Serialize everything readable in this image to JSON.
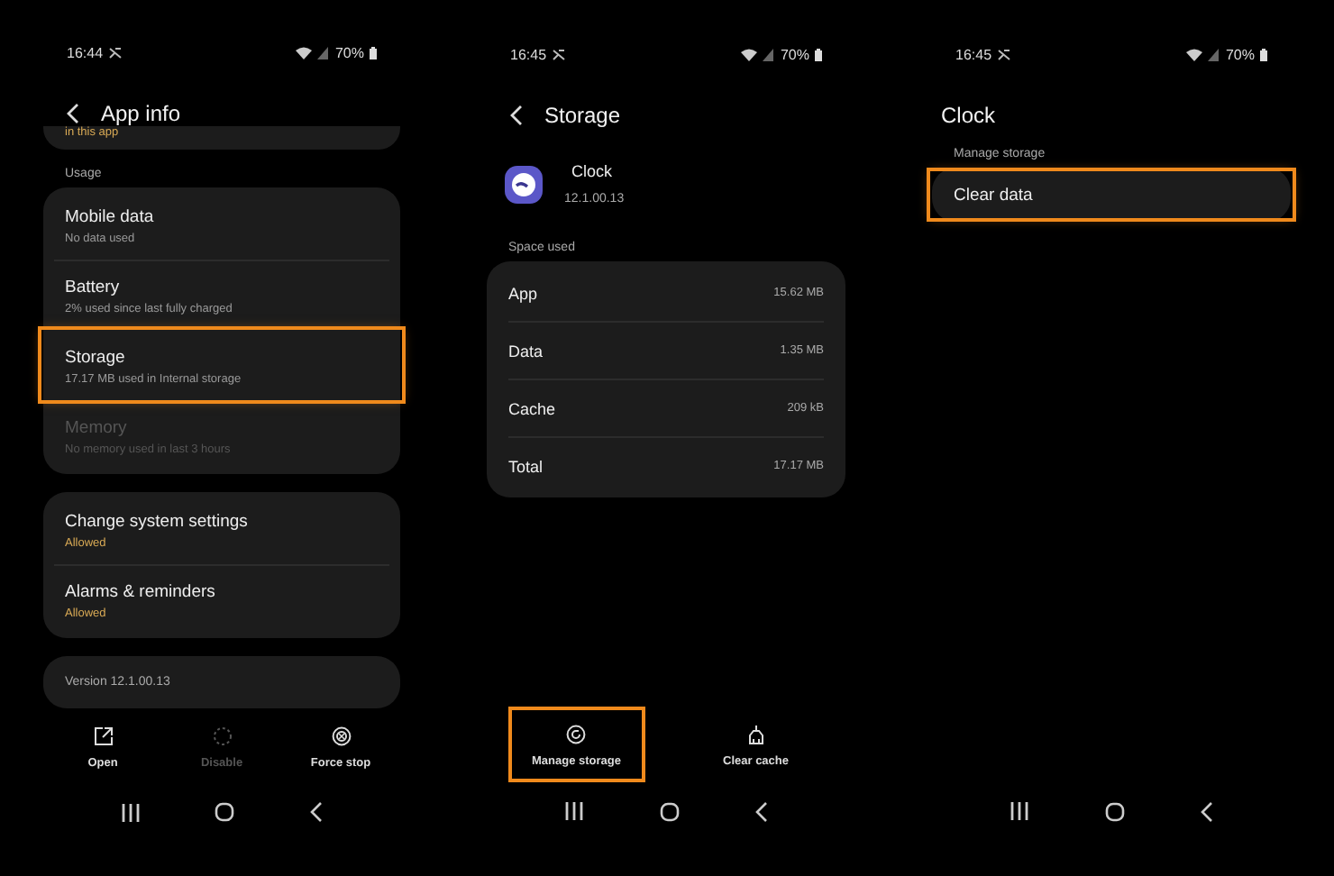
{
  "screens": [
    {
      "kind": "app_info",
      "status": {
        "time": "16:44",
        "battery": "70%"
      },
      "title": "App info",
      "clipped_card": {
        "text": "in this app"
      },
      "sections": [
        {
          "label": "Usage",
          "items": [
            {
              "title": "Mobile data",
              "subtitle": "No data used",
              "disabled": false,
              "accent": false,
              "highlighted": false
            },
            {
              "title": "Battery",
              "subtitle": "2% used since last fully charged",
              "disabled": false,
              "accent": false,
              "highlighted": false
            },
            {
              "title": "Storage",
              "subtitle": "17.17 MB used in Internal storage",
              "disabled": false,
              "accent": false,
              "highlighted": true
            },
            {
              "title": "Memory",
              "subtitle": "No memory used in last 3 hours",
              "disabled": true,
              "accent": false,
              "highlighted": false
            }
          ]
        },
        {
          "items": [
            {
              "title": "Change system settings",
              "subtitle": "Allowed",
              "disabled": false,
              "accent": true,
              "highlighted": false
            },
            {
              "title": "Alarms & reminders",
              "subtitle": "Allowed",
              "disabled": false,
              "accent": true,
              "highlighted": false
            }
          ]
        }
      ],
      "version_card": {
        "text": "Version 12.1.00.13"
      },
      "actions": [
        {
          "label": "Open",
          "kind": "open",
          "disabled": false,
          "highlighted": false
        },
        {
          "label": "Disable",
          "kind": "disable",
          "disabled": true,
          "highlighted": false
        },
        {
          "label": "Force stop",
          "kind": "stop",
          "disabled": false,
          "highlighted": false
        }
      ]
    },
    {
      "kind": "storage",
      "status": {
        "time": "16:45",
        "battery": "70%"
      },
      "title": "Storage",
      "app": {
        "name": "Clock",
        "version": "12.1.00.13"
      },
      "sections": [
        {
          "label": "Space used",
          "rows": [
            {
              "name": "App",
              "value": "15.62 MB"
            },
            {
              "name": "Data",
              "value": "1.35 MB"
            },
            {
              "name": "Cache",
              "value": "209 kB"
            },
            {
              "name": "Total",
              "value": "17.17 MB"
            }
          ]
        }
      ],
      "actions": [
        {
          "label": "Manage storage",
          "kind": "manage",
          "disabled": false,
          "highlighted": true
        },
        {
          "label": "Clear cache",
          "kind": "clean",
          "disabled": false,
          "highlighted": false
        }
      ]
    },
    {
      "kind": "manage",
      "status": {
        "time": "16:45",
        "battery": "70%"
      },
      "title": "Clock",
      "sections": [
        {
          "label": "Manage storage",
          "items": [
            {
              "title": "Clear data",
              "disabled": false,
              "highlighted": true
            }
          ]
        }
      ]
    }
  ]
}
